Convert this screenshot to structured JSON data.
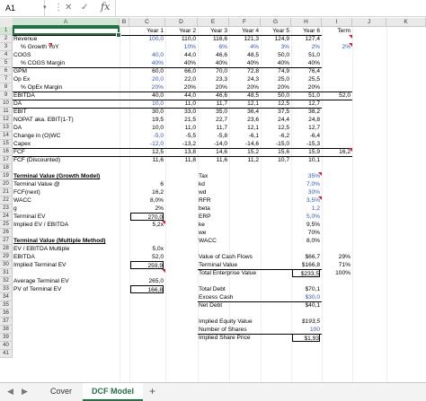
{
  "formula_bar": {
    "name_box": "A1",
    "dropdown_icon": "▾",
    "more_icon": "⋮",
    "cancel_icon": "✕",
    "enter_icon": "✓",
    "fx_label": "fx",
    "formula": ""
  },
  "columns": [
    "A",
    "B",
    "C",
    "D",
    "E",
    "F",
    "G",
    "H",
    "I",
    "J",
    "K"
  ],
  "rows": [
    "1",
    "2",
    "3",
    "4",
    "5",
    "6",
    "7",
    "8",
    "9",
    "10",
    "11",
    "12",
    "13",
    "14",
    "15",
    "16",
    "17",
    "18",
    "19",
    "20",
    "21",
    "22",
    "23",
    "24",
    "25",
    "26",
    "27",
    "28",
    "29",
    "30",
    "31",
    "32",
    "33",
    "34",
    "35",
    "36",
    "37",
    "38",
    "39",
    "40",
    "41"
  ],
  "model": {
    "headers": [
      "Year 1",
      "Year 2",
      "Year 3",
      "Year 4",
      "Year 5",
      "Year 6",
      "Term"
    ],
    "lines": [
      {
        "label": "Revenue",
        "v": [
          "100,0",
          "110,0",
          "116,6",
          "121,3",
          "124,9",
          "127,4",
          ""
        ],
        "blue": [
          true,
          false,
          false,
          false,
          false,
          false
        ]
      },
      {
        "label": "% Growth YoY",
        "v": [
          "",
          "10%",
          "6%",
          "4%",
          "3%",
          "2%",
          "2%"
        ],
        "blue": [
          false,
          true,
          true,
          true,
          true,
          true,
          true
        ]
      },
      {
        "label": "COGS",
        "v": [
          "40,0",
          "44,0",
          "46,6",
          "48,5",
          "50,0",
          "51,0",
          ""
        ],
        "blue": [
          true,
          false,
          false,
          false,
          false,
          false
        ]
      },
      {
        "label": "% COGS Margin",
        "v": [
          "40%",
          "40%",
          "40%",
          "40%",
          "40%",
          "40%",
          ""
        ],
        "blue": [
          true,
          false,
          false,
          false,
          false,
          false
        ]
      },
      {
        "label": "GPM",
        "v": [
          "60,0",
          "66,0",
          "70,0",
          "72,8",
          "74,9",
          "76,4",
          ""
        ],
        "blue": [
          false,
          false,
          false,
          false,
          false,
          false
        ]
      },
      {
        "label": "Op Ex",
        "v": [
          "20,0",
          "22,0",
          "23,3",
          "24,3",
          "25,0",
          "25,5",
          ""
        ],
        "blue": [
          true,
          false,
          false,
          false,
          false,
          false
        ]
      },
      {
        "label": "% OpEx Margin",
        "v": [
          "20%",
          "20%",
          "20%",
          "20%",
          "20%",
          "20%",
          ""
        ],
        "blue": [
          true,
          false,
          false,
          false,
          false,
          false
        ]
      },
      {
        "label": "EBITDA",
        "v": [
          "40,0",
          "44,0",
          "46,6",
          "48,5",
          "50,0",
          "51,0",
          "52,0"
        ],
        "blue": [
          false,
          false,
          false,
          false,
          false,
          false,
          false
        ]
      },
      {
        "label": "DA",
        "v": [
          "10,0",
          "11,0",
          "11,7",
          "12,1",
          "12,5",
          "12,7",
          ""
        ],
        "blue": [
          true,
          false,
          false,
          false,
          false,
          false
        ]
      },
      {
        "label": "EBIT",
        "v": [
          "30,0",
          "33,0",
          "35,0",
          "36,4",
          "37,5",
          "38,2",
          ""
        ],
        "blue": [
          false,
          false,
          false,
          false,
          false,
          false
        ]
      },
      {
        "label": "NOPAT aka. EBIT(1-T)",
        "v": [
          "19,5",
          "21,5",
          "22,7",
          "23,6",
          "24,4",
          "24,8",
          ""
        ],
        "blue": [
          false,
          false,
          false,
          false,
          false,
          false
        ]
      },
      {
        "label": "DA",
        "v": [
          "10,0",
          "11,0",
          "11,7",
          "12,1",
          "12,5",
          "12,7",
          ""
        ],
        "blue": [
          false,
          false,
          false,
          false,
          false,
          false
        ]
      },
      {
        "label": "Change in (O)WC",
        "v": [
          "-5,0",
          "-5,5",
          "-5,8",
          "-6,1",
          "-6,2",
          "-6,4",
          ""
        ],
        "blue": [
          true,
          false,
          false,
          false,
          false,
          false
        ]
      },
      {
        "label": "Capex",
        "v": [
          "-12,0",
          "-13,2",
          "-14,0",
          "-14,6",
          "-15,0",
          "-15,3",
          ""
        ],
        "blue": [
          true,
          false,
          false,
          false,
          false,
          false
        ]
      },
      {
        "label": "FCF",
        "v": [
          "12,5",
          "13,8",
          "14,6",
          "15,2",
          "15,6",
          "15,9",
          "16,2"
        ],
        "blue": [
          false,
          false,
          false,
          false,
          false,
          false,
          false
        ]
      },
      {
        "label": "FCF (Discounted)",
        "v": [
          "11,6",
          "11,8",
          "11,6",
          "11,2",
          "10,7",
          "10,1",
          ""
        ],
        "blue": [
          false,
          false,
          false,
          false,
          false,
          false
        ]
      }
    ]
  },
  "terminal_growth": {
    "title": "Terminal Value (Growth Model)",
    "rows": [
      {
        "label": "Terminal Value @",
        "value": "6",
        "blue": false
      },
      {
        "label": "FCF(next)",
        "value": "16,2",
        "blue": false
      },
      {
        "label": "WACC",
        "value": "8,0%",
        "blue": false
      },
      {
        "label": "g",
        "value": "2%",
        "blue": false
      },
      {
        "label": "Terminal EV",
        "value": "270,0",
        "blue": false
      },
      {
        "label": "Implied EV / EBITDA",
        "value": "5,2x",
        "blue": false
      }
    ]
  },
  "terminal_multiple": {
    "title": "Terminal Value (Multiple Method)",
    "rows": [
      {
        "label": "EV / EBITDA Multiple",
        "value": "5,0x",
        "blue": false
      },
      {
        "label": "EBITDA",
        "value": "52,0",
        "blue": false
      },
      {
        "label": "Implied Terminal EV",
        "value": "259,9",
        "blue": false
      }
    ],
    "average_label": "Average Terminal EV",
    "average_value": "265,0",
    "pv_label": "PV of Terminal EV",
    "pv_value": "166,8"
  },
  "wacc": {
    "rows": [
      {
        "label": "Tax",
        "value": "35%",
        "blue": true
      },
      {
        "label": "kd",
        "value": "7,0%",
        "blue": true
      },
      {
        "label": "wd",
        "value": "30%",
        "blue": true
      },
      {
        "label": "RFR",
        "value": "3,5%",
        "blue": true
      },
      {
        "label": "beta",
        "value": "1,2",
        "blue": true
      },
      {
        "label": "ERP",
        "value": "5,0%",
        "blue": true
      },
      {
        "label": "ke",
        "value": "9,5%",
        "blue": false
      },
      {
        "label": "we",
        "value": "70%",
        "blue": false
      },
      {
        "label": "WACC",
        "value": "8,0%",
        "blue": false
      }
    ]
  },
  "valuation": {
    "value_cf_label": "Value of Cash Flows",
    "value_cf": "$66,7",
    "value_cf_pct": "29%",
    "terminal_label": "Terminal Value",
    "terminal": "$166,8",
    "terminal_pct": "71%",
    "tev_label": "Total Enterprise Value",
    "tev": "$233,5",
    "tev_pct": "100%",
    "total_debt_label": "Total Debt",
    "total_debt": "$70,1",
    "excess_cash_label": "Excess Cash",
    "excess_cash": "$30,0",
    "net_debt_label": "Net Debt",
    "net_debt": "$40,1",
    "equity_label": "Implied Equity Value",
    "equity": "$193,5",
    "shares_label": "Number of Shares",
    "shares": "100",
    "price_label": "Implied Share Price",
    "price": "$1,93"
  },
  "tabs": {
    "prev": "◀",
    "next": "▶",
    "sheets": [
      "Cover",
      "DCF Model"
    ],
    "active": 1,
    "add": "+"
  }
}
